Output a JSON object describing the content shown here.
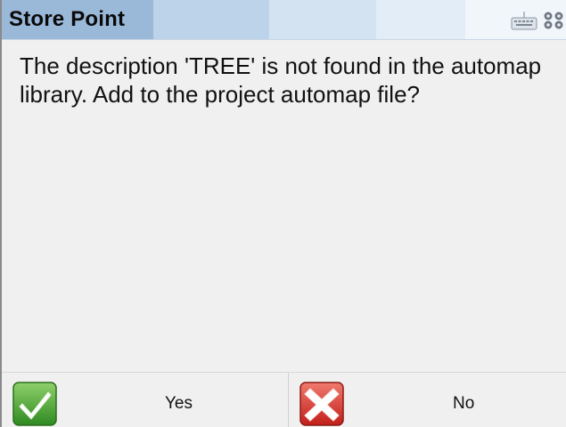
{
  "dialog": {
    "title": "Store Point",
    "message": "The description 'TREE' is not found in the automap library. Add to the project automap file?"
  },
  "title_bar": {
    "icons": [
      "keyboard-icon",
      "gear-icon"
    ]
  },
  "buttons": {
    "yes": {
      "label": "Yes",
      "icon": "check-icon",
      "color": "#3f9a2c"
    },
    "no": {
      "label": "No",
      "icon": "x-icon",
      "color": "#d0302a"
    }
  }
}
